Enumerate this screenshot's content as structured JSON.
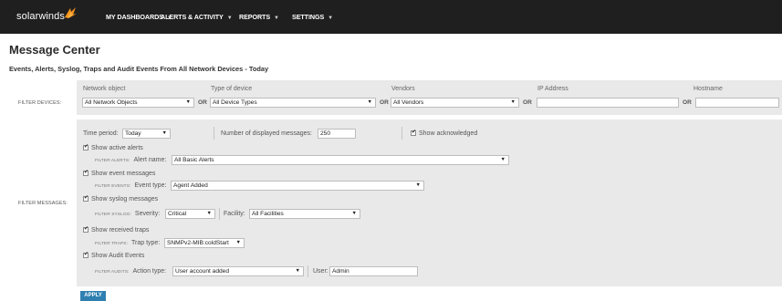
{
  "brand": {
    "logo_text": "solarwinds"
  },
  "nav": [
    {
      "label": "MY DASHBOARDS"
    },
    {
      "label": "ALERTS & ACTIVITY"
    },
    {
      "label": "REPORTS"
    },
    {
      "label": "SETTINGS"
    }
  ],
  "page": {
    "title": "Message Center",
    "subtitle": "Events, Alerts, Syslog, Traps and Audit Events From All Network Devices - Today"
  },
  "filter_devices": {
    "label": "FILTER DEVICES:",
    "or_text": "OR",
    "network_object": {
      "label": "Network object",
      "value": "All Network Objects"
    },
    "device_type": {
      "label": "Type of device",
      "value": "All Device Types"
    },
    "vendors": {
      "label": "Vendors",
      "value": "All Vendors"
    },
    "ip_address": {
      "label": "IP Address",
      "value": ""
    },
    "hostname": {
      "label": "Hostname",
      "value": ""
    }
  },
  "filter_messages": {
    "label": "FILTER MESSAGES:",
    "time_period": {
      "label": "Time period:",
      "value": "Today"
    },
    "num_messages": {
      "label": "Number of displayed messages:",
      "value": "250"
    },
    "show_acknowledged": {
      "label": "Show acknowledged",
      "checked": true
    },
    "alerts": {
      "checkbox_label": "Show active alerts",
      "filter_tag": "FILTER ALERTS:",
      "field_label": "Alert name:",
      "value": "All Basic Alerts"
    },
    "events": {
      "checkbox_label": "Show event messages",
      "filter_tag": "FILTER EVENTS:",
      "field_label": "Event type:",
      "value": "Agent Added"
    },
    "syslog": {
      "checkbox_label": "Show syslog messages",
      "filter_tag": "FILTER SYSLOG:",
      "severity_label": "Severity:",
      "severity_value": "Critical",
      "facility_label": "Facility:",
      "facility_value": "All Facilities"
    },
    "traps": {
      "checkbox_label": "Show received traps",
      "filter_tag": "FILTER TRAPS:",
      "field_label": "Trap type:",
      "value": "SNMPv2-MIB:coldStart"
    },
    "audits": {
      "checkbox_label": "Show Audit Events",
      "filter_tag": "FILTER AUDITS:",
      "action_label": "Action type:",
      "action_value": "User account added",
      "user_label": "User:",
      "user_value": "Admin"
    }
  },
  "apply_label": "APPLY",
  "colors": {
    "topbar": "#1f1f1f",
    "logo_accent": "#f7941d",
    "apply_button": "#2f80b1",
    "panel": "#e9e9e9"
  }
}
